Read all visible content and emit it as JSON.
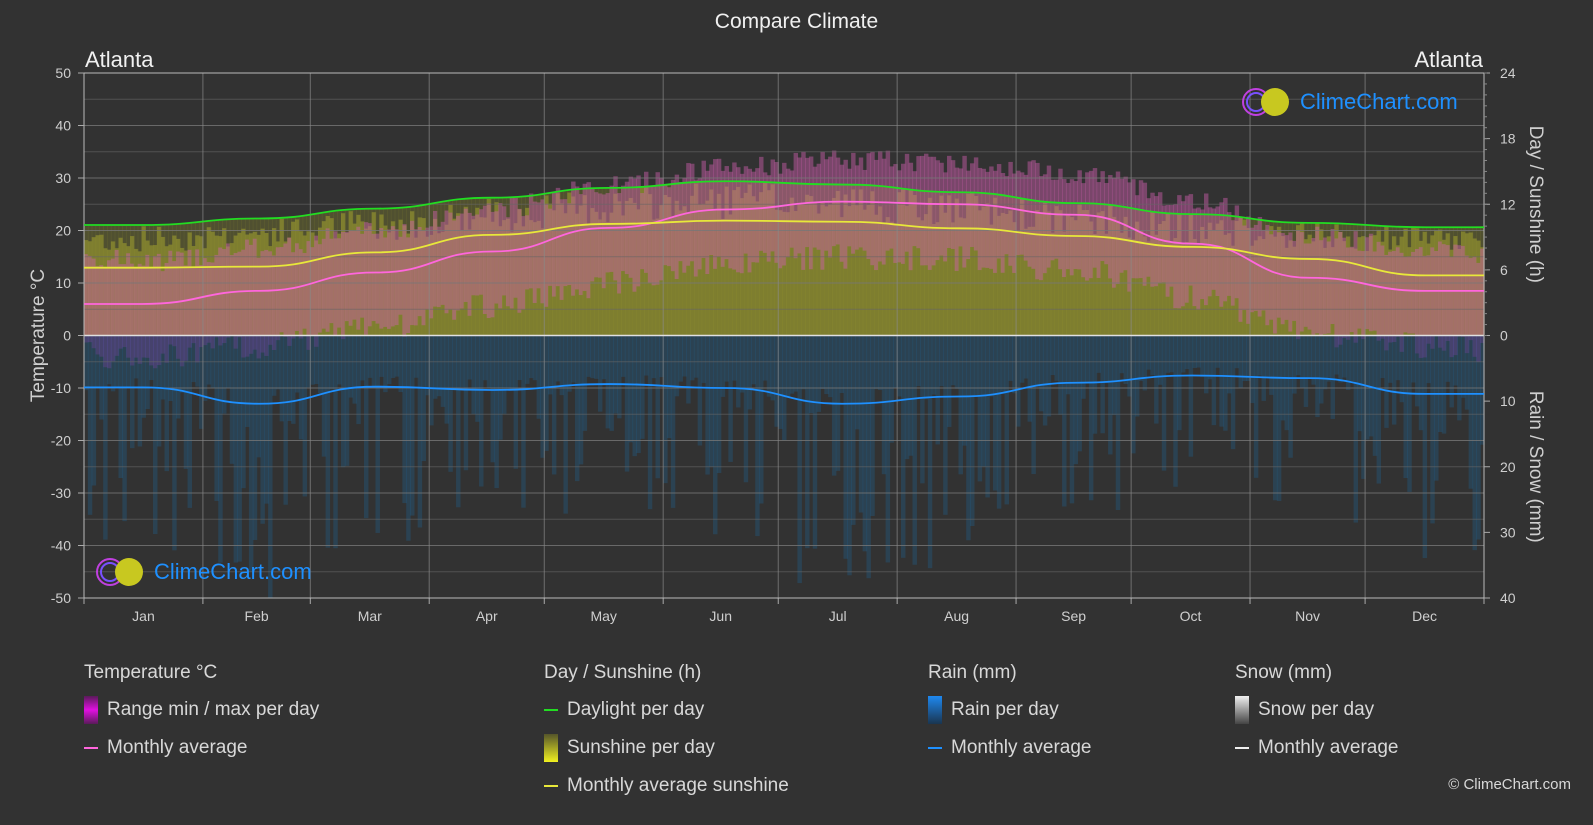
{
  "title": "Compare Climate",
  "city_left": "Atlanta",
  "city_right": "Atlanta",
  "watermark": "ClimeChart.com",
  "copyright": "© ClimeChart.com",
  "legend": {
    "temperature": {
      "header": "Temperature °C",
      "items": [
        {
          "label": "Range min / max per day",
          "type": "box",
          "color": "#e020e0"
        },
        {
          "label": "Monthly average",
          "type": "line",
          "color": "#ff66dd"
        }
      ]
    },
    "sunshine": {
      "header": "Day / Sunshine (h)",
      "items": [
        {
          "label": "Daylight per day",
          "type": "line",
          "color": "#22dd22"
        },
        {
          "label": "Sunshine per day",
          "type": "box",
          "color": "#e0e030"
        },
        {
          "label": "Monthly average sunshine",
          "type": "line",
          "color": "#e8e83a"
        }
      ]
    },
    "rain": {
      "header": "Rain (mm)",
      "items": [
        {
          "label": "Rain per day",
          "type": "box",
          "color": "#1e88e5"
        },
        {
          "label": "Monthly average",
          "type": "line",
          "color": "#1e90ff"
        }
      ]
    },
    "snow": {
      "header": "Snow (mm)",
      "items": [
        {
          "label": "Snow per day",
          "type": "box",
          "color": "#dddddd"
        },
        {
          "label": "Monthly average",
          "type": "line",
          "color": "#eeeeee"
        }
      ]
    }
  },
  "chart_data": {
    "type": "line",
    "title": "Compare Climate",
    "categories": [
      "Jan",
      "Feb",
      "Mar",
      "Apr",
      "May",
      "Jun",
      "Jul",
      "Aug",
      "Sep",
      "Oct",
      "Nov",
      "Dec"
    ],
    "left_axis": {
      "label": "Temperature °C",
      "range": [
        -50,
        50
      ],
      "ticks": [
        50,
        40,
        30,
        20,
        10,
        0,
        -10,
        -20,
        -30,
        -40,
        -50
      ]
    },
    "right_axis_top": {
      "label": "Day / Sunshine (h)",
      "range": [
        0,
        24
      ],
      "ticks": [
        24,
        18,
        12,
        6,
        0
      ]
    },
    "right_axis_bottom": {
      "label": "Rain / Snow (mm)",
      "range": [
        0,
        40
      ],
      "ticks": [
        0,
        10,
        20,
        30,
        40
      ]
    },
    "grid": true,
    "series": [
      {
        "name": "Temperature monthly average (°C)",
        "axis": "left",
        "color": "#ff66dd",
        "values": [
          6,
          8.5,
          12,
          16,
          20.5,
          24,
          25.5,
          25,
          23,
          17.5,
          11,
          8.5
        ]
      },
      {
        "name": "Daylight per day (h)",
        "axis": "right_top",
        "color": "#22dd22",
        "values": [
          10.1,
          10.7,
          11.6,
          12.6,
          13.5,
          14.1,
          13.8,
          13.1,
          12.1,
          11.1,
          10.3,
          9.9
        ]
      },
      {
        "name": "Monthly average sunshine (h)",
        "axis": "right_top",
        "color": "#e8e83a",
        "values": [
          6.2,
          6.3,
          7.6,
          9.2,
          10.2,
          10.5,
          10.4,
          9.8,
          9.1,
          8.1,
          7.0,
          5.5
        ]
      },
      {
        "name": "Rain monthly average (mm)",
        "axis": "right_bottom",
        "color": "#1e90ff",
        "values": [
          7.9,
          10.4,
          7.8,
          8.3,
          7.4,
          8.0,
          10.4,
          9.3,
          7.2,
          6.1,
          6.5,
          8.9
        ]
      }
    ]
  }
}
